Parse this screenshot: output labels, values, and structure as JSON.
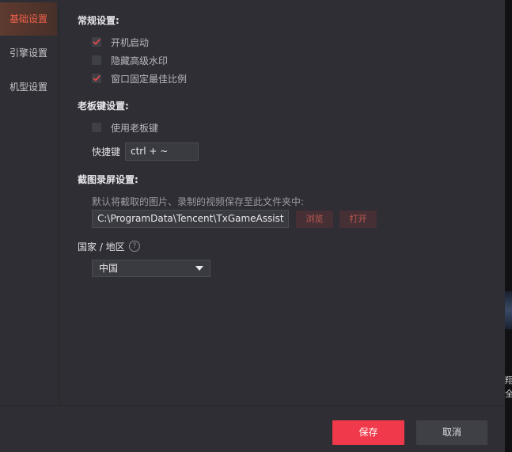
{
  "sidebar": {
    "items": [
      {
        "label": "基础设置",
        "active": true
      },
      {
        "label": "引擎设置",
        "active": false
      },
      {
        "label": "机型设置",
        "active": false
      }
    ]
  },
  "general": {
    "title": "常规设置:",
    "options": [
      {
        "label": "开机启动",
        "checked": true
      },
      {
        "label": "隐藏高级水印",
        "checked": false
      },
      {
        "label": "窗口固定最佳比例",
        "checked": true
      }
    ]
  },
  "boss_key": {
    "title": "老板键设置:",
    "option": {
      "label": "使用老板键",
      "checked": false
    },
    "shortcut_label": "快捷键",
    "shortcut_value": "ctrl + ~"
  },
  "capture": {
    "title": "截图录屏设置:",
    "hint": "默认将截取的图片、录制的视频保存至此文件夹中:",
    "path": "C:\\ProgramData\\Tencent\\TxGameAssist",
    "browse_label": "浏览",
    "open_label": "打开"
  },
  "region": {
    "title": "国家 / 地区",
    "help_icon": "?",
    "selected": "中国"
  },
  "footer": {
    "save_label": "保存",
    "cancel_label": "取消"
  },
  "background": {
    "text_line1": "翔",
    "text_line2": "全"
  },
  "colors": {
    "accent": "#f0394a",
    "active_nav_text": "#f0604a",
    "checkmark": "#e04b4b",
    "panel_bg": "#2e2e34"
  },
  "icons": {
    "checkmark": "check-icon",
    "caret": "chevron-down-icon",
    "help": "question-circle-icon"
  }
}
